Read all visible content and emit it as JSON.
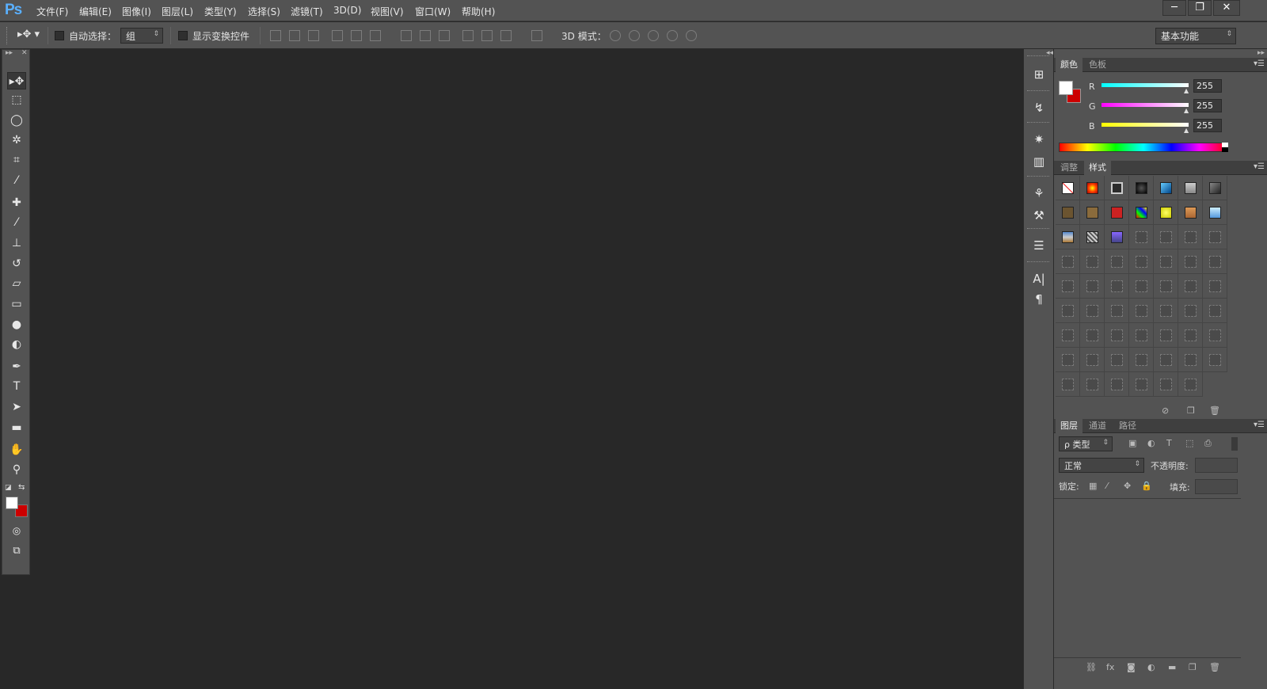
{
  "app": {
    "logo": "Ps"
  },
  "menu": [
    "文件(F)",
    "编辑(E)",
    "图像(I)",
    "图层(L)",
    "类型(Y)",
    "选择(S)",
    "滤镜(T)",
    "3D(D)",
    "视图(V)",
    "窗口(W)",
    "帮助(H)"
  ],
  "window_buttons": {
    "minimize": "─",
    "restore": "❐",
    "close": "✕"
  },
  "options": {
    "auto_select_label": "自动选择：",
    "auto_select_value": "组",
    "show_transform_label": "显示变换控件",
    "mode_3d_label": "3D 模式：",
    "workspace": "基本功能"
  },
  "tools": [
    {
      "name": "move-tool",
      "glyph": "▸✥",
      "active": true
    },
    {
      "name": "marquee-tool",
      "glyph": "⬚"
    },
    {
      "name": "lasso-tool",
      "glyph": "◯"
    },
    {
      "name": "magic-wand-tool",
      "glyph": "✲"
    },
    {
      "name": "crop-tool",
      "glyph": "⌗"
    },
    {
      "name": "eyedropper-tool",
      "glyph": "⁄"
    },
    {
      "name": "healing-brush-tool",
      "glyph": "✚"
    },
    {
      "name": "brush-tool",
      "glyph": "⁄"
    },
    {
      "name": "clone-stamp-tool",
      "glyph": "⊥"
    },
    {
      "name": "history-brush-tool",
      "glyph": "↺"
    },
    {
      "name": "eraser-tool",
      "glyph": "▱"
    },
    {
      "name": "gradient-tool",
      "glyph": "▭"
    },
    {
      "name": "blur-tool",
      "glyph": "●"
    },
    {
      "name": "dodge-tool",
      "glyph": "◐"
    },
    {
      "name": "pen-tool",
      "glyph": "✒"
    },
    {
      "name": "type-tool",
      "glyph": "T"
    },
    {
      "name": "path-selection-tool",
      "glyph": "➤"
    },
    {
      "name": "rectangle-tool",
      "glyph": "▬"
    },
    {
      "name": "hand-tool",
      "glyph": "✋"
    },
    {
      "name": "zoom-tool",
      "glyph": "⚲"
    }
  ],
  "dock_icons": [
    "history-icon",
    "actions-icon",
    "properties-icon",
    "info-icon",
    "brushes-icon",
    "brush-presets-icon",
    "adjust-icon",
    "character-icon",
    "paragraph-icon"
  ],
  "dock_glyphs": [
    "⊞",
    "↯",
    "✷",
    "▥",
    "⚘",
    "⚒",
    "☰",
    "A|",
    "¶"
  ],
  "color_panel": {
    "tabs": [
      "颜色",
      "色板"
    ],
    "channels": [
      {
        "label": "R",
        "value": "255",
        "color": "#00ffff"
      },
      {
        "label": "G",
        "value": "255",
        "color": "#ff00ff"
      },
      {
        "label": "B",
        "value": "255",
        "color": "#ffff00"
      }
    ],
    "foreground": "#ffffff",
    "background": "#cc0000"
  },
  "styles_panel": {
    "tabs": [
      "调整",
      "样式"
    ]
  },
  "layers_panel": {
    "tabs": [
      "图层",
      "通道",
      "路径"
    ],
    "filter_label": "ρ 类型",
    "blend_mode": "正常",
    "opacity_label": "不透明度:",
    "lock_label": "锁定:",
    "fill_label": "填充:"
  },
  "colors": {
    "ui_bg": "#535353",
    "canvas": "#282828",
    "accent": "#5ab0ff"
  }
}
